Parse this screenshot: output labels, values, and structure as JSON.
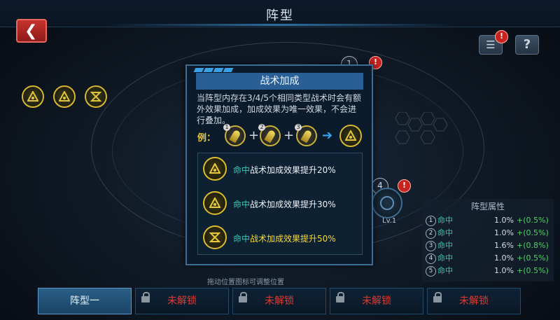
{
  "header": {
    "title": "阵型"
  },
  "modal": {
    "title": "战术加成",
    "description": "当阵型内存在3/4/5个相同类型战术时会有额外效果加成，加成效果为唯一效果，不会进行叠加。",
    "example_label": "例：",
    "example_numbers": [
      "1",
      "2",
      "3"
    ],
    "bonuses": [
      {
        "attr": "命中",
        "rest": "战术加成效果提升20%",
        "highlight": false
      },
      {
        "attr": "命中",
        "rest": "战术加成效果提升30%",
        "highlight": false
      },
      {
        "attr": "命中",
        "rest": "战术加成效果提升50%",
        "highlight": true
      }
    ]
  },
  "slots": {
    "slot1_num": "1",
    "slot4_num": "4",
    "lv_label": "Lv.1"
  },
  "alert_mark": "!",
  "icons": {
    "back": "back-arrow-icon",
    "list": "list-icon",
    "help": "help-icon",
    "help_glyph": "?"
  },
  "attributes": {
    "title": "阵型属性",
    "rows": [
      {
        "num": "1",
        "label": "命中",
        "value": "1.0%",
        "gain": "+(0.5%)"
      },
      {
        "num": "2",
        "label": "命中",
        "value": "1.0%",
        "gain": "+(0.5%)"
      },
      {
        "num": "3",
        "label": "命中",
        "value": "1.6%",
        "gain": "+(0.8%)"
      },
      {
        "num": "4",
        "label": "命中",
        "value": "1.0%",
        "gain": "+(0.5%)"
      },
      {
        "num": "5",
        "label": "命中",
        "value": "1.0%",
        "gain": "+(0.5%)"
      }
    ]
  },
  "hint": "拖动位置图标可调整位置",
  "tabs": [
    {
      "label": "阵型一",
      "state": "active"
    },
    {
      "label": "未解锁",
      "state": "locked"
    },
    {
      "label": "未解锁",
      "state": "locked"
    },
    {
      "label": "未解锁",
      "state": "locked"
    },
    {
      "label": "未解锁",
      "state": "locked"
    }
  ],
  "colors": {
    "accent": "#2a5f96",
    "gold": "#d9bd2a",
    "teal": "#37c8b4",
    "green": "#4bd166",
    "locked": "#e03a30"
  }
}
